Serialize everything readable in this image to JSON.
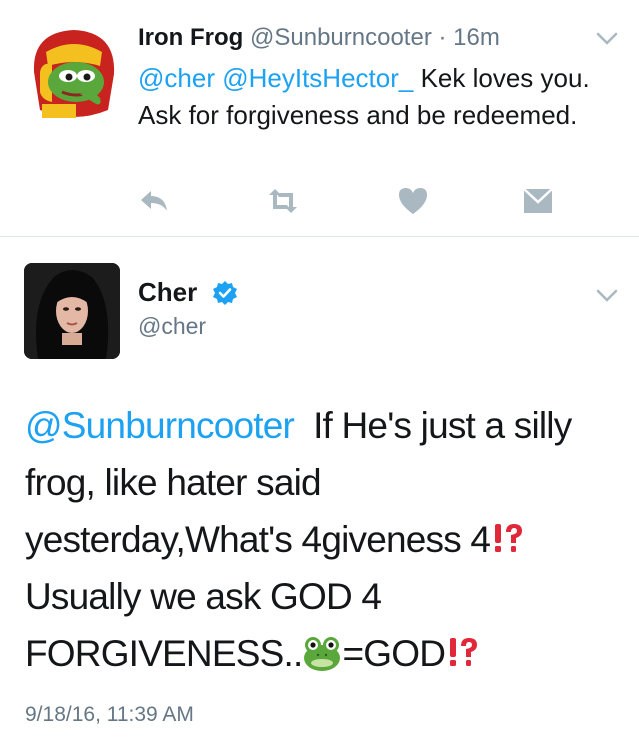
{
  "reply": {
    "name": "Iron Frog",
    "handle": "@Sunburncooter",
    "separator": "·",
    "time": "16m",
    "mention1": "@cher",
    "mention2": "@HeyItsHector_",
    "text": "Kek loves you. Ask for forgiveness and be redeemed.",
    "actions": [
      "reply-icon",
      "retweet-icon",
      "like-icon",
      "message-icon"
    ]
  },
  "tweet": {
    "name": "Cher",
    "handle": "@cher",
    "mention": "@Sunburncooter",
    "line1": "If He's  just a silly",
    "line2": "frog, like hater said",
    "line3": "yesterday,What's 4giveness 4",
    "line4": "Usually we ask GOD 4",
    "line5a": "FORGIVENESS..",
    "line5b": "=GOD",
    "timestamp": "9/18/16, 11:39 AM"
  },
  "colors": {
    "accent": "#1da1f2",
    "secondary_text": "#657786",
    "icon": "#aab8c2",
    "divider": "#e1e8ed",
    "bang_red": "#e0283a",
    "frog_green": "#5aa83c"
  }
}
